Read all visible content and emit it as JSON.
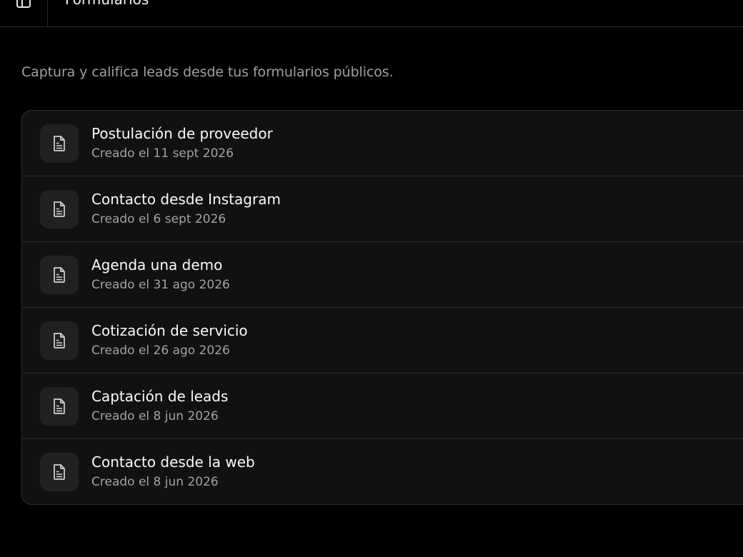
{
  "header": {
    "title": "Formularios",
    "sidebar_toggle_icon": "sidebar-panel-icon"
  },
  "description": "Captura y califica leads desde tus formularios públicos.",
  "forms": [
    {
      "name": "Postulación de proveedor",
      "created": "Creado el 11 sept 2026",
      "icon": "document-icon"
    },
    {
      "name": "Contacto desde Instagram",
      "created": "Creado el 6 sept 2026",
      "icon": "document-icon"
    },
    {
      "name": "Agenda una demo",
      "created": "Creado el 31 ago 2026",
      "icon": "document-icon"
    },
    {
      "name": "Cotización de servicio",
      "created": "Creado el 26 ago 2026",
      "icon": "document-icon"
    },
    {
      "name": "Captación de leads",
      "created": "Creado el 8 jun 2026",
      "icon": "document-icon"
    },
    {
      "name": "Contacto desde la web",
      "created": "Creado el 8 jun 2026",
      "icon": "document-icon"
    }
  ],
  "colors": {
    "background": "#000000",
    "card": "#111111",
    "icon_box": "#212121",
    "border": "#2e2e2e",
    "muted_text": "#a3a3a3"
  }
}
